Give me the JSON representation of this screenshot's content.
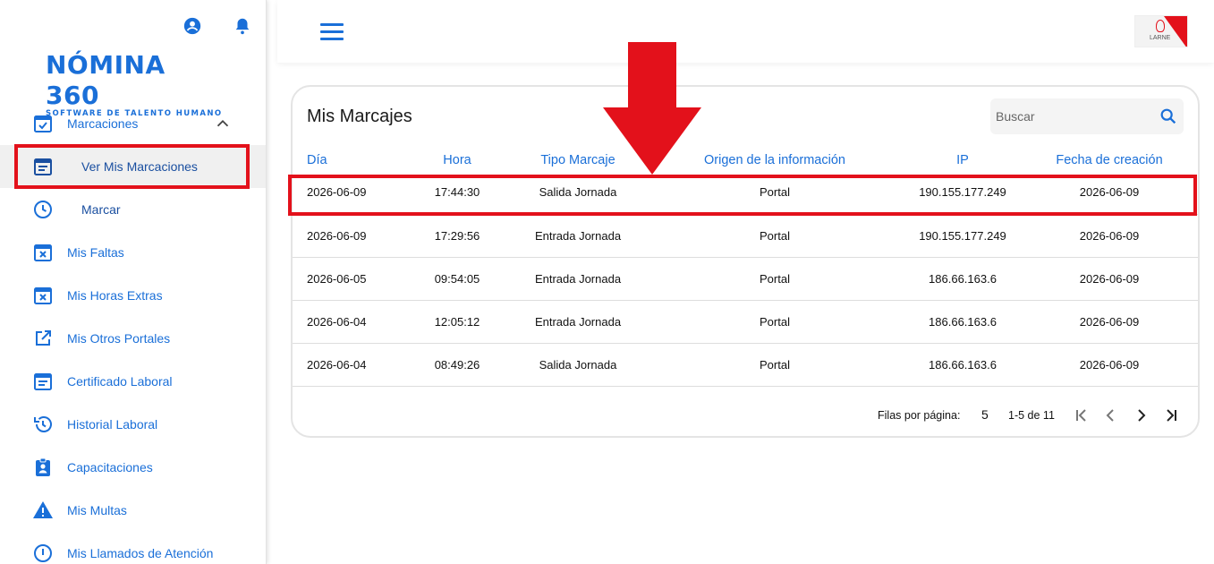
{
  "header": {
    "brand_logo_text": "LARNE"
  },
  "sidebar": {
    "logo_title": "NÓMINA 360",
    "logo_subtitle": "SOFTWARE DE TALENTO HUMANO",
    "items": [
      {
        "label": "Marcaciones",
        "icon": "calendar-check-icon"
      },
      {
        "label": "Ver Mis Marcaciones",
        "icon": "calendar-list-icon"
      },
      {
        "label": "Marcar",
        "icon": "clock-icon"
      },
      {
        "label": "Mis Faltas",
        "icon": "calendar-x-icon"
      },
      {
        "label": "Mis Horas Extras",
        "icon": "calendar-x-icon"
      },
      {
        "label": "Mis Otros Portales",
        "icon": "open-in-new-icon"
      },
      {
        "label": "Certificado Laboral",
        "icon": "calendar-list-icon"
      },
      {
        "label": "Historial Laboral",
        "icon": "history-icon"
      },
      {
        "label": "Capacitaciones",
        "icon": "assignment-ind-icon"
      },
      {
        "label": "Mis Multas",
        "icon": "warning-icon"
      },
      {
        "label": "Mis Llamados de Atención",
        "icon": "info-icon"
      }
    ]
  },
  "main": {
    "title": "Mis Marcajes",
    "search": {
      "placeholder": "Buscar"
    },
    "columns": [
      "Día",
      "Hora",
      "Tipo Marcaje",
      "Origen de la información",
      "IP",
      "Fecha de creación"
    ],
    "rows": [
      [
        "2026-06-09",
        "17:44:30",
        "Salida Jornada",
        "Portal",
        "190.155.177.249",
        "2026-06-09"
      ],
      [
        "2026-06-09",
        "17:29:56",
        "Entrada Jornada",
        "Portal",
        "190.155.177.249",
        "2026-06-09"
      ],
      [
        "2026-06-05",
        "09:54:05",
        "Entrada Jornada",
        "Portal",
        "186.66.163.6",
        "2026-06-09"
      ],
      [
        "2026-06-04",
        "12:05:12",
        "Entrada Jornada",
        "Portal",
        "186.66.163.6",
        "2026-06-09"
      ],
      [
        "2026-06-04",
        "08:49:26",
        "Salida Jornada",
        "Portal",
        "186.66.163.6",
        "2026-06-09"
      ]
    ],
    "pagination": {
      "rows_per_page_label": "Filas por página:",
      "rows_per_page": "5",
      "range": "1-5 de 11"
    }
  },
  "colors": {
    "accent": "#1a6fd8",
    "annotation": "#e3111b"
  }
}
